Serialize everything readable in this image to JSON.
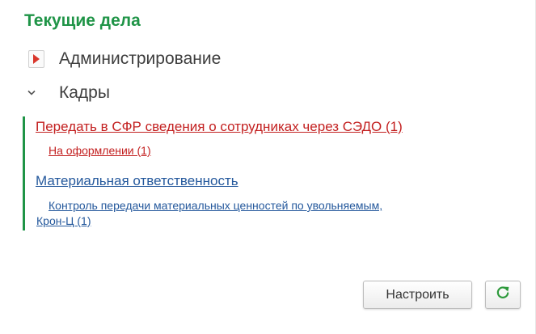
{
  "header": {
    "title": "Текущие дела"
  },
  "sections": [
    {
      "label": "Администрирование",
      "state": "collapsed"
    },
    {
      "label": "Кадры",
      "state": "expanded"
    }
  ],
  "tasks": [
    {
      "label": "Передать в СФР сведения о сотрудниках через СЭДО (1)",
      "sub": "На оформлении (1)"
    },
    {
      "label": "Материальная ответственность",
      "sub_line1": "Контроль передачи материальных ценностей по увольняемым,",
      "sub_line2": "Крон-Ц (1)"
    }
  ],
  "buttons": {
    "configure": "Настроить",
    "refresh_icon": "refresh-icon"
  },
  "colors": {
    "title": "#1f9447",
    "overdue_link": "#c32020",
    "link": "#24589c",
    "accent_bar": "#1f9447",
    "expand_arrow": "#d9362b"
  }
}
